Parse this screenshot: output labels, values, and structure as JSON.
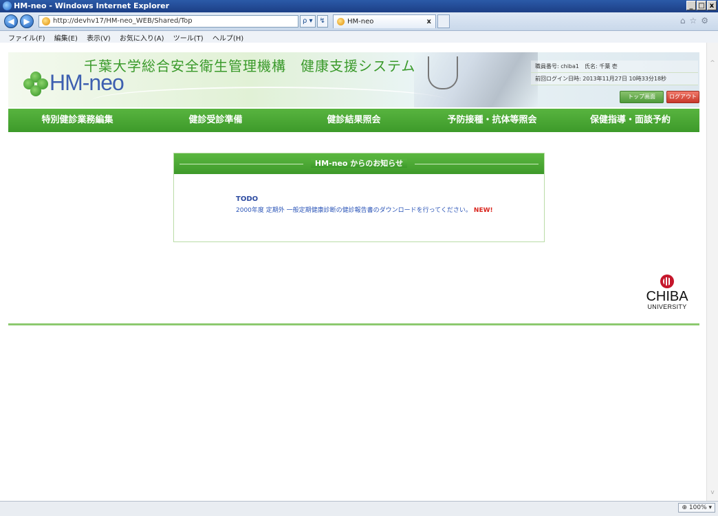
{
  "window": {
    "title": "HM-neo - Windows Internet Explorer",
    "controls": [
      "_",
      "□",
      "x"
    ]
  },
  "browser": {
    "back_glyph": "◀",
    "forward_glyph": "▶",
    "url": "http://devhv17/HM-neo_WEB/Shared/Top",
    "addr_tools": [
      "ρ ▾",
      "↯",
      ""
    ],
    "tab_title": "HM-neo",
    "tab_close": "x",
    "right_glyphs": "⌂☆⚙",
    "menu": [
      "ファイル(F)",
      "編集(E)",
      "表示(V)",
      "お気に入り(A)",
      "ツール(T)",
      "ヘルプ(H)"
    ],
    "zoom": "⊕ 100% ▾"
  },
  "header": {
    "logo_text": "HM-neo",
    "system_title": "千葉大学総合安全衛生管理機構　健康支援システム",
    "user_line": "職員番号: chiba1　氏名: 千葉 壱",
    "last_login": "前回ログイン日時: 2013年11月27日 10時33分18秒",
    "top_button": "トップ画面",
    "logout_button": "ログアウト"
  },
  "nav": {
    "items": [
      "特別健診業務編集",
      "健診受診準備",
      "健診結果照会",
      "予防接種・抗体等照会",
      "保健指導・面談予約"
    ]
  },
  "notice": {
    "title": "HM-neo からのお知らせ",
    "todo_label": "TODO",
    "message": "2000年度 定期外 一般定期健康診断の健診報告書のダウンロードを行ってください。",
    "new_badge": "NEW!"
  },
  "university": {
    "name": "CHIBA",
    "sub": "UNIVERSITY"
  },
  "colors": {
    "nav_green": "#4aa834",
    "accent_red": "#c8382a",
    "text_blue": "#2c56b8"
  }
}
